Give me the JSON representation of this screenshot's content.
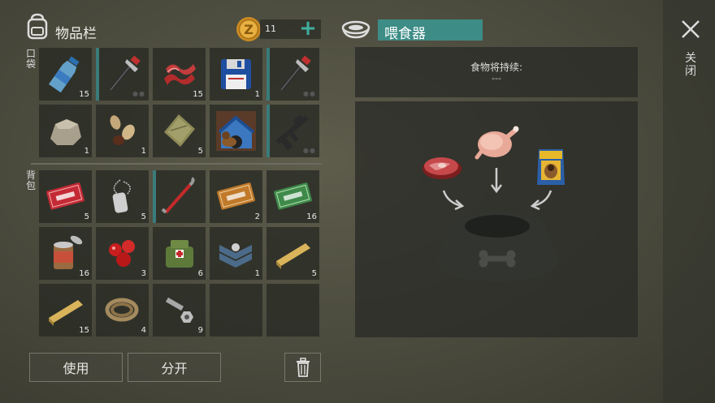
{
  "inventory": {
    "title": "物品栏",
    "coins": "11",
    "pocket_label": "口袋",
    "backpack_label": "背包",
    "pocket_slots": [
      {
        "icon": "water-bottle-icon",
        "count": "15",
        "bar": false,
        "dots": false
      },
      {
        "icon": "hammer-icon",
        "count": "",
        "bar": true,
        "dots": true
      },
      {
        "icon": "bacon-icon",
        "count": "15",
        "bar": false,
        "dots": false
      },
      {
        "icon": "floppy-disk-icon",
        "count": "1",
        "bar": false,
        "dots": false
      },
      {
        "icon": "hammer-icon",
        "count": "",
        "bar": true,
        "dots": true
      },
      {
        "icon": "stone-icon",
        "count": "1",
        "bar": false,
        "dots": false
      },
      {
        "icon": "seeds-icon",
        "count": "1",
        "bar": false,
        "dots": false
      },
      {
        "icon": "cloth-icon",
        "count": "5",
        "bar": false,
        "dots": false
      },
      {
        "icon": "dog-kennel-icon",
        "count": "",
        "bar": false,
        "dots": false
      },
      {
        "icon": "assault-rifle-icon",
        "count": "",
        "bar": true,
        "dots": true
      }
    ],
    "backpack_slots": [
      {
        "icon": "combat-coupon-icon",
        "count": "5",
        "bar": false,
        "dots": false
      },
      {
        "icon": "dog-tag-icon",
        "count": "5",
        "bar": false,
        "dots": false
      },
      {
        "icon": "crowbar-icon",
        "count": "",
        "bar": true,
        "dots": false
      },
      {
        "icon": "orange-coupon-icon",
        "count": "2",
        "bar": false,
        "dots": false
      },
      {
        "icon": "ration-coupon-icon",
        "count": "16",
        "bar": false,
        "dots": false
      },
      {
        "icon": "canned-food-icon",
        "count": "16",
        "bar": false,
        "dots": false
      },
      {
        "icon": "berries-icon",
        "count": "3",
        "bar": false,
        "dots": false
      },
      {
        "icon": "medkit-bag-icon",
        "count": "6",
        "bar": false,
        "dots": false
      },
      {
        "icon": "sergeant-chevron-icon",
        "count": "1",
        "bar": false,
        "dots": false
      },
      {
        "icon": "wood-plank-icon",
        "count": "5",
        "bar": false,
        "dots": false
      },
      {
        "icon": "wood-plank-icon",
        "count": "15",
        "bar": false,
        "dots": false
      },
      {
        "icon": "rope-icon",
        "count": "4",
        "bar": false,
        "dots": false
      },
      {
        "icon": "nuts-bolts-icon",
        "count": "9",
        "bar": false,
        "dots": false
      },
      {
        "icon": "empty-slot",
        "count": "",
        "bar": false,
        "dots": false
      },
      {
        "icon": "empty-slot",
        "count": "",
        "bar": false,
        "dots": false
      }
    ],
    "use_button": "使用",
    "split_button": "分开"
  },
  "feeder": {
    "title": "喂食器",
    "duration_label": "食物将持续:",
    "duration_value": "---"
  },
  "close_label": "关闭",
  "colors": {
    "accent": "#3d8c86",
    "coin": "#d9a032",
    "title_bar": "#3d8c86"
  }
}
